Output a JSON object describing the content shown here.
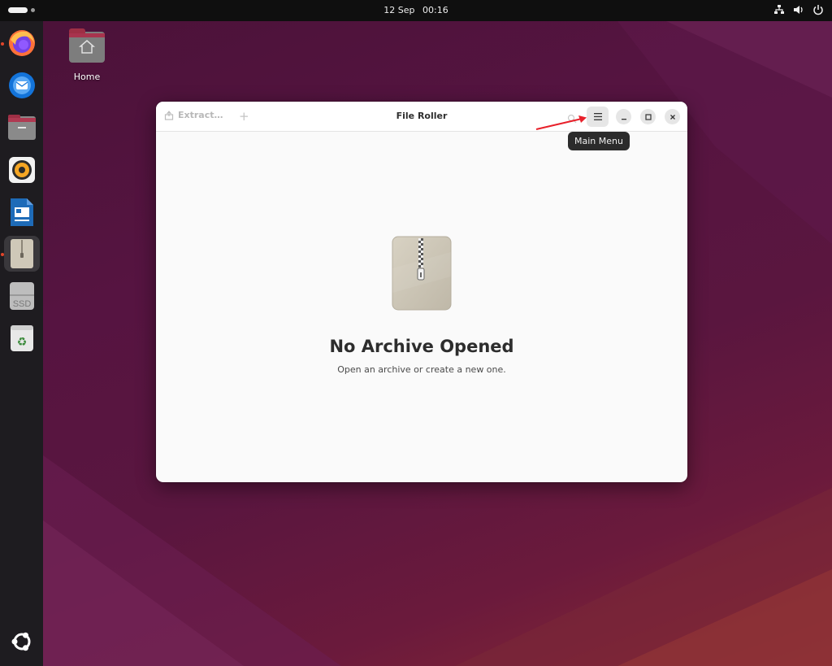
{
  "topbar": {
    "date": "12 Sep",
    "time": "00:16",
    "tray_icons": [
      "network-icon",
      "volume-icon",
      "power-icon"
    ]
  },
  "dock": {
    "items": [
      {
        "name": "firefox",
        "icon": "firefox-icon",
        "running": true
      },
      {
        "name": "thunderbird",
        "icon": "thunderbird-icon",
        "running": false
      },
      {
        "name": "files",
        "icon": "files-icon",
        "running": false
      },
      {
        "name": "rhythmbox",
        "icon": "rhythmbox-icon",
        "running": false
      },
      {
        "name": "libreoffice-writer",
        "icon": "writer-icon",
        "running": false
      },
      {
        "name": "file-roller",
        "icon": "archive-icon",
        "running": true,
        "active": true
      },
      {
        "name": "ssd",
        "icon": "ssd-drive-icon",
        "label": "SSD",
        "running": false
      },
      {
        "name": "trash",
        "icon": "trash-icon",
        "running": false
      }
    ],
    "show_apps_icon": "ubuntu-logo-icon"
  },
  "desktop": {
    "home_label": "Home"
  },
  "window": {
    "title": "File Roller",
    "extract_label": "Extract…",
    "add_label": "+",
    "empty_title": "No Archive Opened",
    "empty_subtitle": "Open an archive or create a new one."
  },
  "tooltip": {
    "text": "Main Menu"
  },
  "colors": {
    "annotation_arrow": "#e8202a",
    "accent_running": "#e0452a"
  }
}
